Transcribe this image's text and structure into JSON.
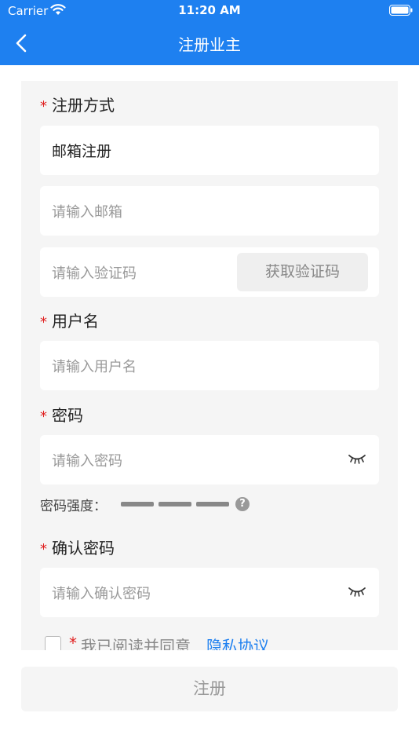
{
  "status_bar": {
    "carrier": "Carrier",
    "time": "11:20 AM"
  },
  "nav": {
    "title": "注册业主",
    "back_icon": "chevron-left-icon"
  },
  "form": {
    "method_label": "注册方式",
    "method_value": "邮箱注册",
    "email_placeholder": "请输入邮箱",
    "code_placeholder": "请输入验证码",
    "get_code_label": "获取验证码",
    "username_label": "用户名",
    "username_placeholder": "请输入用户名",
    "password_label": "密码",
    "password_placeholder": "请输入密码",
    "strength_label": "密码强度：",
    "help_symbol": "?",
    "confirm_label": "确认密码",
    "confirm_placeholder": "请输入确认密码",
    "required_mark": "*"
  },
  "agreement": {
    "text": "我已阅读并同意",
    "link": "隐私协议"
  },
  "submit_label": "注册",
  "colors": {
    "primary": "#1e80f0",
    "required": "#e02020",
    "background": "#f5f5f5"
  }
}
